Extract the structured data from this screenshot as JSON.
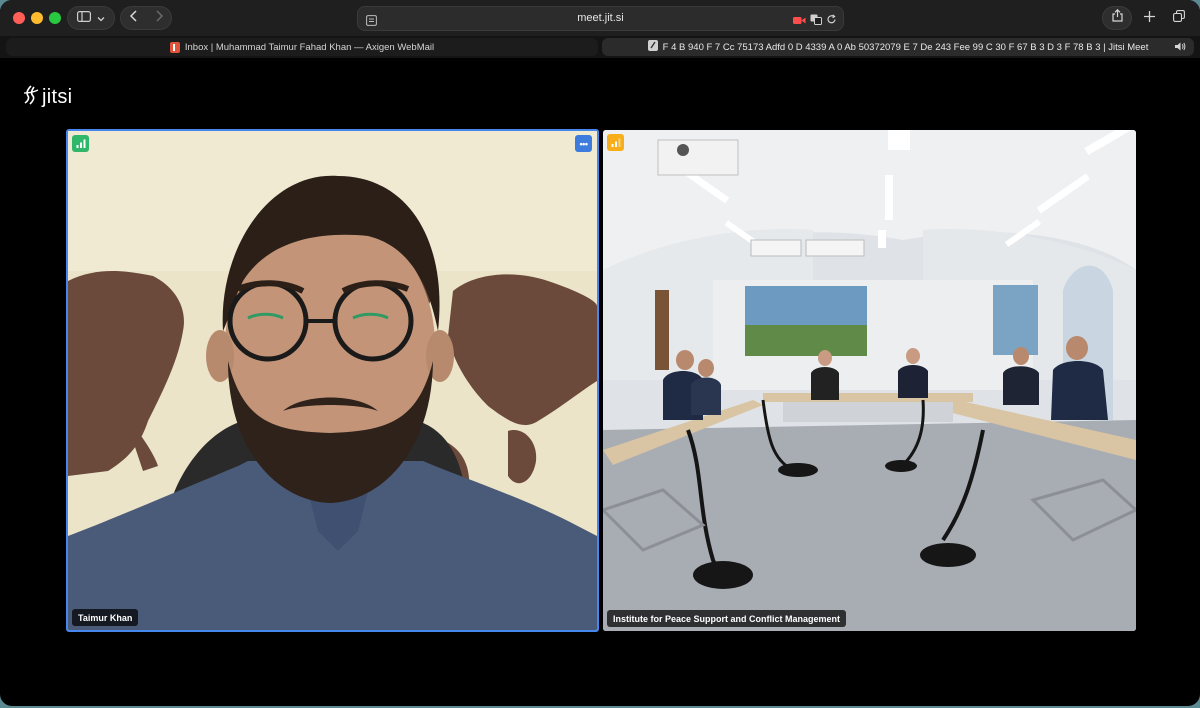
{
  "browser": {
    "url": "meet.jit.si",
    "tabs": [
      {
        "title": "Inbox | Muhammad Taimur Fahad Khan — Axigen WebMail",
        "favicon": "axigen-icon",
        "active": false
      },
      {
        "title": "F 4 B 940 F 7 Cc 75173 Adfd 0 D 4339 A 0 Ab 50372079 E 7 De 243 Fee 99 C 30 F 67 B 3 D 3 F 78 B 3 | Jitsi Meet",
        "favicon": "jitsi-icon",
        "active": true
      }
    ]
  },
  "app": {
    "logo_text": "jitsi"
  },
  "participants": [
    {
      "name": "Taimur Khan",
      "connection": "good",
      "active_speaker": true
    },
    {
      "name": "Institute for Peace Support and Conflict Management",
      "connection": "fair",
      "active_speaker": false
    }
  ],
  "colors": {
    "accent": "#4687ed",
    "connection_good": "#31b76a",
    "connection_fair": "#f8ae1a",
    "window_bg": "#000000"
  }
}
